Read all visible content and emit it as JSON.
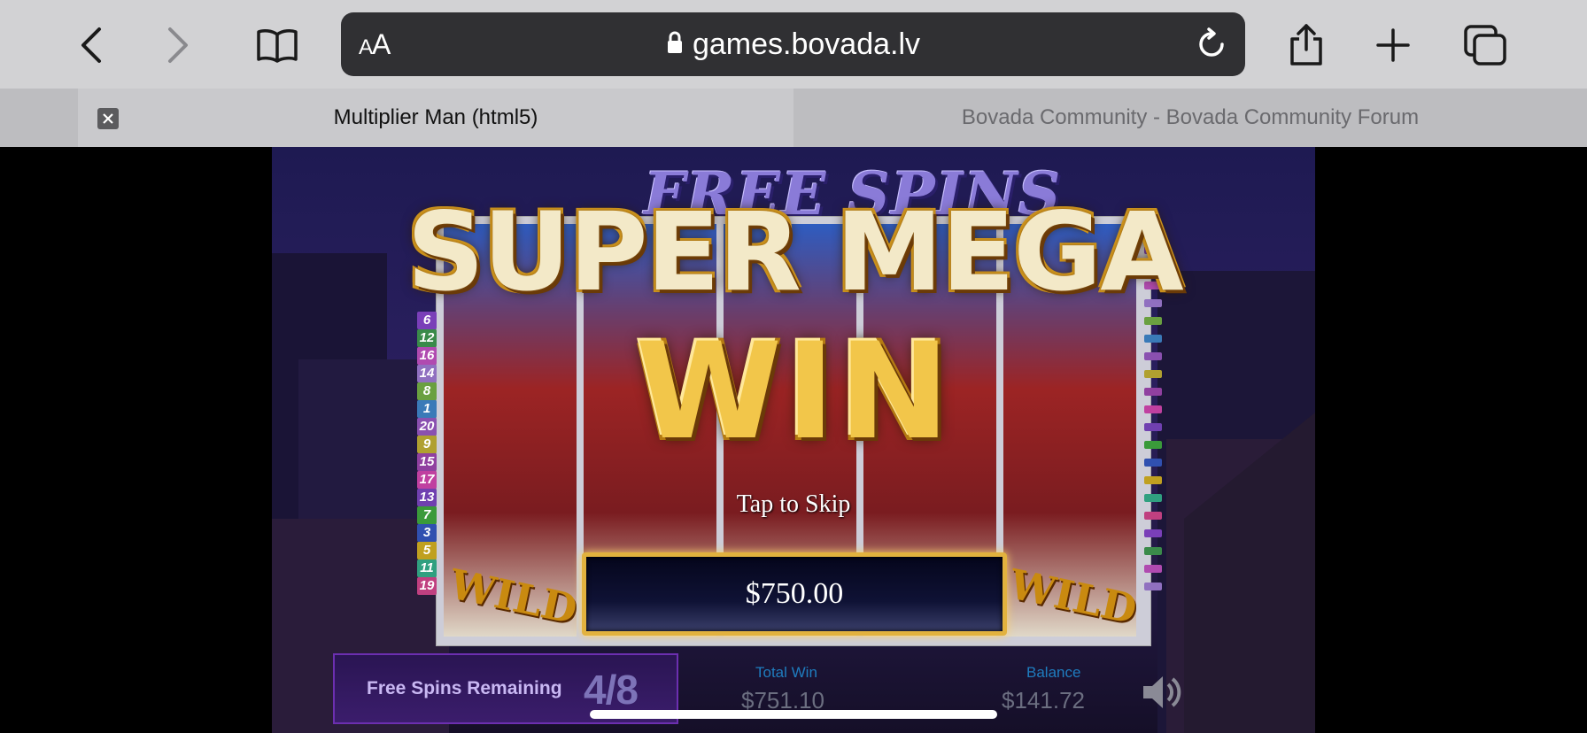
{
  "browser": {
    "text_size_label": "AA",
    "url": "games.bovada.lv",
    "tabs": [
      {
        "title": "Multiplier Man (html5)",
        "active": true
      },
      {
        "title": "Bovada Community - Bovada Community Forum",
        "active": false
      }
    ]
  },
  "game": {
    "free_spins_title": "FREE SPINS",
    "super_mega_text": "SUPER MEGA",
    "win_text": "WIN",
    "tap_to_skip": "Tap to Skip",
    "win_amount": "$750.00",
    "wild_label": "WILD",
    "free_spins_remaining_label": "Free Spins Remaining",
    "free_spins_remaining_value": "4/8",
    "total_win_label": "Total Win",
    "total_win_value": "$751.10",
    "balance_label": "Balance",
    "balance_value": "$141.72",
    "paylines_left": [
      "6",
      "12",
      "16",
      "14",
      "8",
      "1",
      "20",
      "9",
      "15",
      "17",
      "13",
      "7",
      "3",
      "5",
      "11",
      "19"
    ],
    "payline_colors": [
      "#7a3fb8",
      "#3a8a4a",
      "#b04ab0",
      "#9070c0",
      "#6aa040",
      "#3a7ab8",
      "#8a50b0",
      "#b0a030",
      "#9040a0",
      "#c040a0",
      "#7040b0",
      "#3a9a3a",
      "#3050b0",
      "#c0a020",
      "#30a080",
      "#c04080"
    ]
  }
}
